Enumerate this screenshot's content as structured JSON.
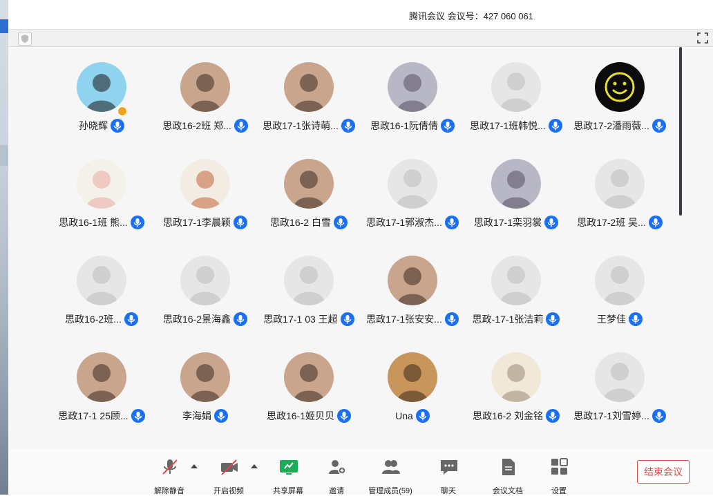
{
  "window": {
    "title": "腾讯会议 会议号：427 060 061"
  },
  "participants": [
    {
      "name": "孙晓辉",
      "avatar": "photo-silhouette",
      "host": true
    },
    {
      "name": "思政16-2班 郑...",
      "avatar": "photo-person"
    },
    {
      "name": "思政17-1张诗萌...",
      "avatar": "photo-person"
    },
    {
      "name": "思政16-1阮倩倩",
      "avatar": "photo-anime"
    },
    {
      "name": "思政17-1班韩悦...",
      "avatar": "default"
    },
    {
      "name": "思政17-2潘雨薇...",
      "avatar": "photo-smiley"
    },
    {
      "name": "思政16-1班 熊...",
      "avatar": "photo-rabbit"
    },
    {
      "name": "思政17-1李晨颖",
      "avatar": "photo-fox"
    },
    {
      "name": "思政16-2  白雪",
      "avatar": "photo-person"
    },
    {
      "name": "思政17-1郭淑杰...",
      "avatar": "default"
    },
    {
      "name": "思政17-1栾羽裳",
      "avatar": "photo-anime"
    },
    {
      "name": "思政17-2班 吴...",
      "avatar": "default"
    },
    {
      "name": "思政16-2班...",
      "avatar": "default"
    },
    {
      "name": "思政16-2景海鑫",
      "avatar": "default"
    },
    {
      "name": "思政17-1 03 王超",
      "avatar": "default"
    },
    {
      "name": "思政17-1张安安...",
      "avatar": "photo-person"
    },
    {
      "name": "思政-17-1张洁莉",
      "avatar": "default"
    },
    {
      "name": "王梦佳",
      "avatar": "default"
    },
    {
      "name": "思政17-1 25顾...",
      "avatar": "photo-person"
    },
    {
      "name": "李海娟",
      "avatar": "photo-person"
    },
    {
      "name": "思政16-1姬贝贝",
      "avatar": "photo-person"
    },
    {
      "name": "Una",
      "avatar": "photo-child"
    },
    {
      "name": "思政16-2 刘金铭",
      "avatar": "photo-cat"
    },
    {
      "name": "思政17-1刘雪婷...",
      "avatar": "default"
    }
  ],
  "toolbar": {
    "unmute": "解除静音",
    "start_video": "开启视频",
    "share_screen": "共享屏幕",
    "invite": "邀请",
    "manage_members": "管理成员(59)",
    "chat": "聊天",
    "meeting_docs": "会议文档",
    "settings": "设置",
    "end_meeting": "结束会议"
  },
  "colors": {
    "accent": "#1a6ff2",
    "danger": "#e04848",
    "share_green": "#1aad5a"
  }
}
